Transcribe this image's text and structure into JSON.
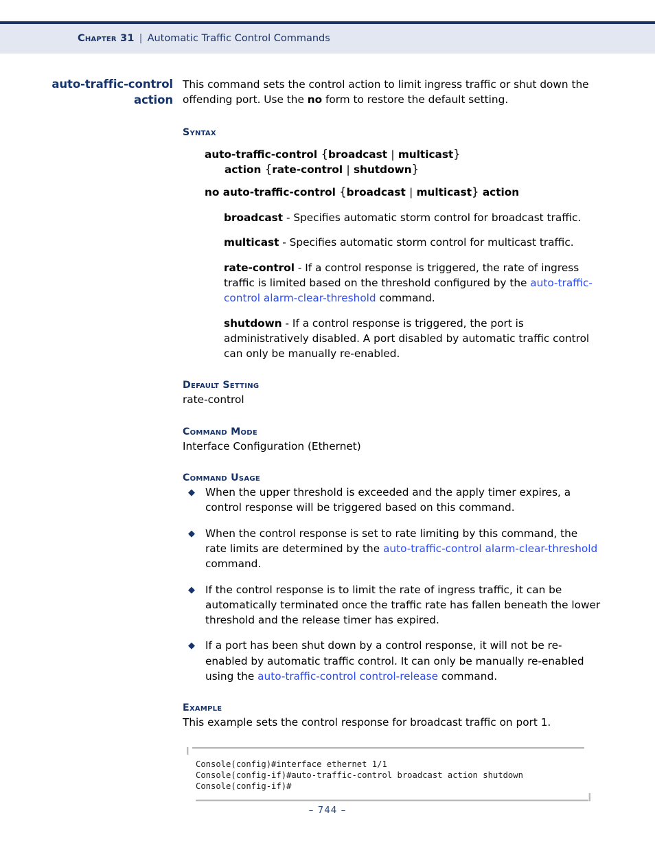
{
  "header": {
    "chapter_label": "Chapter 31",
    "separator": "|",
    "title": "Automatic Traffic Control Commands"
  },
  "command": {
    "title_line1": "auto-traffic-control",
    "title_line2": "action",
    "intro_part1": "This command sets the control action to limit ingress traffic or shut down the offending port. Use the ",
    "intro_bold": "no",
    "intro_part2": " form to restore the default setting."
  },
  "sections": {
    "syntax_heading": "Syntax",
    "default_setting_heading": "Default Setting",
    "default_setting_value": "rate-control",
    "command_mode_heading": "Command Mode",
    "command_mode_value": "Interface Configuration (Ethernet)",
    "command_usage_heading": "Command Usage",
    "example_heading": "Example",
    "example_intro": "This example sets the control response for broadcast traffic on port 1."
  },
  "syntax": {
    "line1_cmd": "auto-traffic-control",
    "line1_open": "{",
    "line1_opt1": "broadcast",
    "line1_pipe": "|",
    "line1_opt2": "multicast",
    "line1_close": "}",
    "line2_cmd": "action",
    "line2_open": "{",
    "line2_opt1": "rate-control",
    "line2_pipe": "|",
    "line2_opt2": "shutdown",
    "line2_close": "}",
    "line3_cmd": "no auto-traffic-control",
    "line3_open": "{",
    "line3_opt1": "broadcast",
    "line3_pipe": "|",
    "line3_opt2": "multicast",
    "line3_close": "}",
    "line3_tail": "action"
  },
  "parameters": [
    {
      "term": "broadcast",
      "text_before": " - Specifies automatic storm control for broadcast traffic.",
      "link": "",
      "text_after": ""
    },
    {
      "term": "multicast",
      "text_before": " - Specifies automatic storm control for multicast traffic.",
      "link": "",
      "text_after": ""
    },
    {
      "term": "rate-control",
      "text_before": " - If a control response is triggered, the rate of ingress traffic is limited based on the threshold configured by the ",
      "link": "auto-traffic-control alarm-clear-threshold",
      "text_after": " command."
    },
    {
      "term": "shutdown",
      "text_before": " - If a control response is triggered, the port is administratively disabled. A port disabled by automatic traffic control can only be manually re-enabled.",
      "link": "",
      "text_after": ""
    }
  ],
  "usage_bullets": [
    {
      "bullet_glyph": "◆",
      "text_before": "When the upper threshold is exceeded and the apply timer expires, a control response will be triggered based on this command.",
      "link": "",
      "text_after": ""
    },
    {
      "bullet_glyph": "◆",
      "text_before": "When the control response is set to rate limiting by this command, the rate limits are determined by the ",
      "link": "auto-traffic-control alarm-clear-threshold",
      "text_after": " command."
    },
    {
      "bullet_glyph": "◆",
      "text_before": "If the control response is to limit the rate of ingress traffic, it can be automatically terminated once the traffic rate has fallen beneath the lower threshold and the release timer has expired.",
      "link": "",
      "text_after": ""
    },
    {
      "bullet_glyph": "◆",
      "text_before": "If a port has been shut down by a control response, it will not be re-enabled by automatic traffic control. It can only be manually re-enabled using the ",
      "link": "auto-traffic-control control-release",
      "text_after": " command."
    }
  ],
  "console": {
    "line1": "Console(config)#interface ethernet 1/1",
    "line2": "Console(config-if)#auto-traffic-control broadcast action shutdown",
    "line3": "Console(config-if)#"
  },
  "footer": {
    "page_number": "–  744  –"
  },
  "colors": {
    "header_band": "#e3e7f1",
    "navy": "#16346b",
    "link_blue": "#2b4cf0",
    "rule_dark": "#1b3365"
  }
}
